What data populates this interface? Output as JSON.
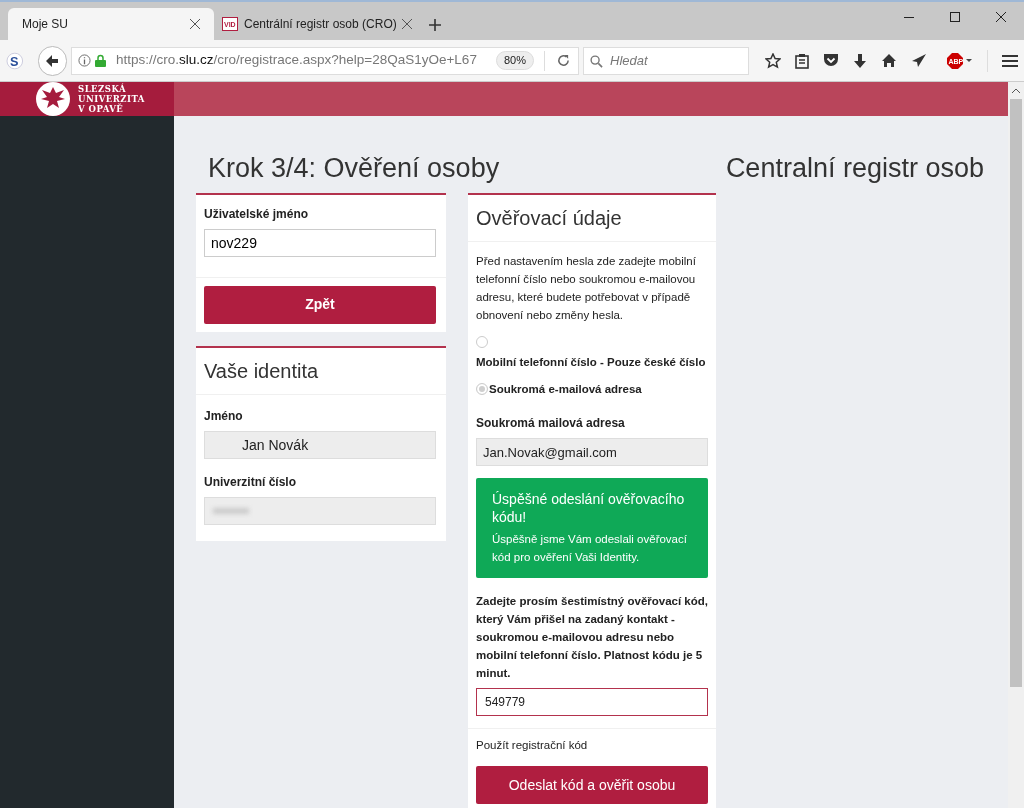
{
  "browser": {
    "tabs": [
      {
        "title": "Moje SU",
        "selected": true
      },
      {
        "title": "Centrální registr osob (CRO)",
        "selected": false
      }
    ],
    "tab_icon_text": "VID",
    "extension_icon_text": "S",
    "adblock_icon_text": "ABP",
    "url_prefix": "https://cro.",
    "url_domain": "slu.cz",
    "url_rest": "/cro/registrace.aspx?help=28QaS1yOe+L67",
    "zoom": "80%",
    "search_placeholder": "Hledat"
  },
  "header": {
    "logo_lines": [
      "SLEZSKÁ",
      "UNIVERZITA",
      "V OPAVĚ"
    ]
  },
  "page_title": "Krok 3/4: Ověření osoby",
  "app_title": "Centralní registr osob",
  "login_card": {
    "username_label": "Uživatelské jméno",
    "username": "nov229",
    "back_button": "Zpět"
  },
  "identity_card": {
    "title": "Vaše identita",
    "name_label": "Jméno",
    "name": "Jan Novák",
    "number_label": "Univerzitní číslo"
  },
  "verify_card": {
    "title": "Ověřovací údaje",
    "intro": "Před nastavením hesla zde zadejte mobilní telefonní číslo nebo soukromou e-mailovou adresu, které budete potřebovat v případě obnovení nebo změny hesla.",
    "options": [
      {
        "kind": "stacked",
        "label": "Mobilní telefonní číslo - Pouze české číslo",
        "selected": false
      },
      {
        "kind": "inline",
        "label": "Soukromá e-mailová adresa",
        "selected": true
      }
    ],
    "email_label": "Soukromá mailová adresa",
    "email": "Jan.Novak@gmail.com",
    "alert": {
      "title": "Úspěšné odeslání ověřovacího kódu!",
      "text": "Úspěšně jsme Vám odeslali ověřovací kód pro ověření Vaši Identity."
    },
    "code_label": "Zadejte prosím šestimístný ověřovací kód, který Vám přišel na zadaný kontakt - soukromou e-mailovou adresu nebo mobilní telefonní číslo. Platnost kódu je 5 minut.",
    "code": "549779",
    "alt_link": "Použít registrační kód",
    "submit_button": "Odeslat kód a ověřit osobu"
  }
}
